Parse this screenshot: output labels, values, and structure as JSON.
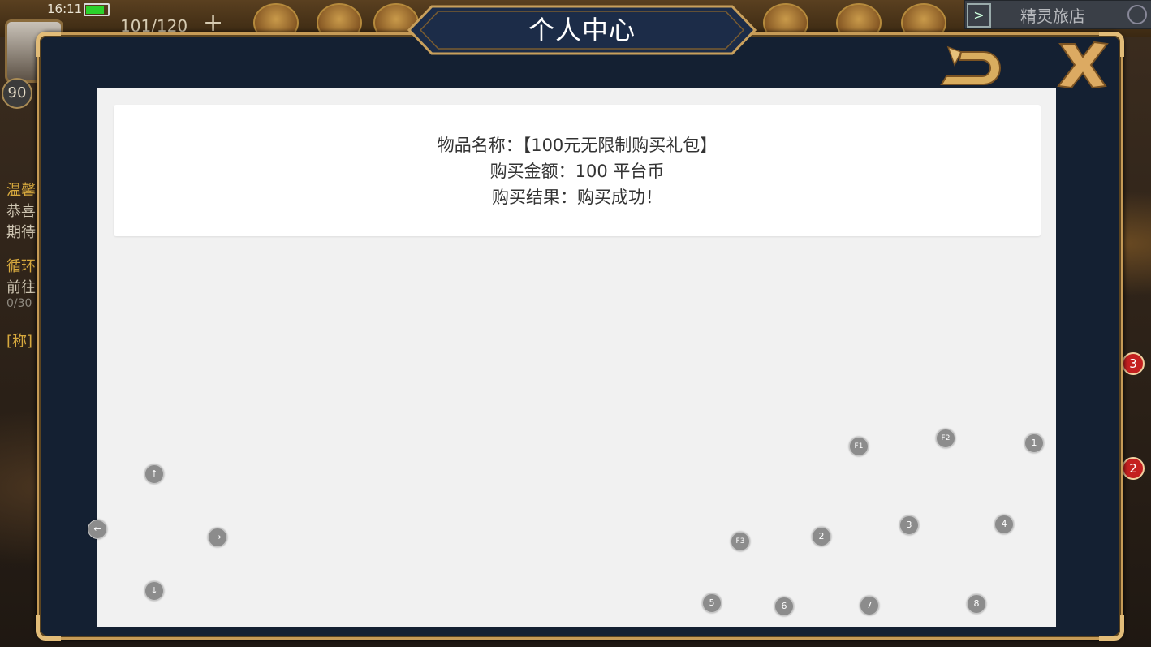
{
  "status": {
    "time": "16:11",
    "energy": "101/120",
    "energy_add": "+",
    "level": "90"
  },
  "top_right_tab": {
    "label": "精灵旅店",
    "arrow": ">"
  },
  "side_texts": [
    "温馨",
    "恭喜",
    "期待",
    "循环",
    "前往",
    "0/30",
    "[称]"
  ],
  "side_badges": [
    "3",
    "2"
  ],
  "dialog": {
    "title": "个人中心"
  },
  "purchase": {
    "item_line": "物品名称：【100元无限制购买礼包】",
    "amount_line": "购买金额：100 平台币",
    "result_line": "购买结果：购买成功！"
  },
  "keys": {
    "up": "↑",
    "left": "←",
    "right": "→",
    "down": "↓",
    "f1": "F1",
    "f2": "F2",
    "f3": "F3",
    "k1": "1",
    "k2": "2",
    "k3": "3",
    "k4": "4",
    "k5": "5",
    "k6": "6",
    "k7": "7",
    "k8": "8"
  },
  "colors": {
    "frame_gold": "#c69b57",
    "frame_bg": "#142032",
    "content_bg": "#f1f1f1",
    "key_bg": "#8c8c8c"
  }
}
